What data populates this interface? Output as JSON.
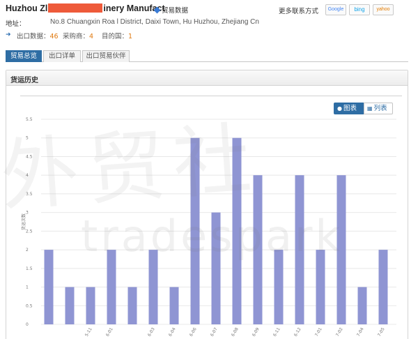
{
  "header": {
    "company_start": "Huzhou Zl",
    "company_end": "inery Manufact",
    "trade_data_link": "贸易数据",
    "more_contact_label": "更多联系方式",
    "search_engines": [
      "Google",
      "bing",
      "yahoo"
    ]
  },
  "address": {
    "label": "地址：",
    "value": "No.8 Chuangxin Roa          l District, Daixi Town, Hu Huzhou, Zhejiang Cn"
  },
  "stats": {
    "export_label": "出口数据：",
    "export_value": "46",
    "buyers_label": "采购商：",
    "buyers_value": "4",
    "dest_label": "目的国：",
    "dest_value": "1"
  },
  "tabs": [
    {
      "label": "贸易总览",
      "active": true
    },
    {
      "label": "出口详单",
      "active": false
    },
    {
      "label": "出口贸易伙伴",
      "active": false
    }
  ],
  "panel": {
    "title": "货运历史",
    "view_chart_label": "图表",
    "view_list_label": "列表"
  },
  "watermark": {
    "cn_text": "外贸社",
    "en_text": "tradespark"
  },
  "colors": {
    "bar": "#8f95d3",
    "accent": "#2e6da4",
    "number": "#e07a10",
    "redaction": "#ee5a3a"
  },
  "chart_data": {
    "type": "bar",
    "ylabel": "货运次数",
    "ylim": [
      0,
      5.5
    ],
    "yticks": [
      "0",
      "0.5",
      "1",
      "1.5",
      "2",
      "2.5",
      "3",
      "3.5",
      "4",
      "4.5",
      "5",
      "5.5"
    ],
    "categories": [
      "",
      "",
      "5-11",
      "6-01",
      "",
      "6-03",
      "6-04",
      "6-06",
      "6-07",
      "6-08",
      "6-09",
      "6-11",
      "6-12",
      "7-01",
      "7-02",
      "7-04",
      "7-05"
    ],
    "values": [
      2,
      1,
      1,
      2,
      1,
      2,
      1,
      5,
      3,
      5,
      4,
      2,
      4,
      2,
      4,
      1,
      2
    ]
  }
}
